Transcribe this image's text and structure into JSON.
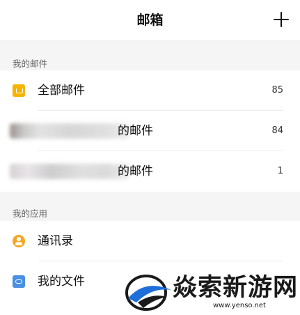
{
  "header": {
    "title": "邮箱"
  },
  "sections": {
    "my_mail": {
      "title": "我的邮件"
    },
    "my_apps": {
      "title": "我的应用"
    }
  },
  "mail_items": [
    {
      "label": "全部邮件",
      "count": "85",
      "icon": "inbox-icon"
    },
    {
      "label": "的邮件",
      "count": "84",
      "icon": "account-avatar"
    },
    {
      "label": "的邮件",
      "count": "1",
      "icon": "account-avatar"
    }
  ],
  "app_items": [
    {
      "label": "通讯录",
      "icon": "contacts-icon"
    },
    {
      "label": "我的文件",
      "icon": "cloud-folder-icon"
    }
  ],
  "watermark": {
    "text": "焱索新游网",
    "url": "www.yenso.net"
  },
  "colors": {
    "inbox": "#f6b400",
    "contacts": "#f5a623",
    "files": "#4a90e2"
  }
}
